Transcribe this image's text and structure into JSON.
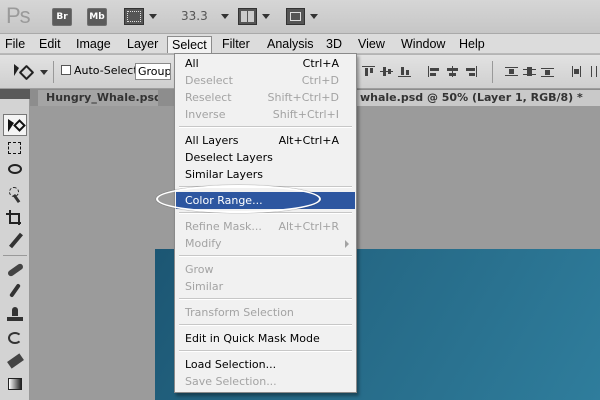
{
  "app": {
    "logo": "Ps",
    "bridge_label": "Br",
    "minibridge_label": "Mb",
    "zoom": "33.3"
  },
  "menubar": [
    {
      "label": "File"
    },
    {
      "label": "Edit"
    },
    {
      "label": "Image"
    },
    {
      "label": "Layer"
    },
    {
      "label": "Select"
    },
    {
      "label": "Filter"
    },
    {
      "label": "Analysis"
    },
    {
      "label": "3D"
    },
    {
      "label": "View"
    },
    {
      "label": "Window"
    },
    {
      "label": "Help"
    }
  ],
  "options": {
    "auto_select_label": "Auto-Select:",
    "group_value": "Group"
  },
  "tabs": {
    "first": "Hungry_Whale.psd @",
    "second": "whale.psd @ 50% (Layer 1, RGB/8) *"
  },
  "select_menu": {
    "all": {
      "label": "All",
      "shortcut": "Ctrl+A"
    },
    "deselect": {
      "label": "Deselect",
      "shortcut": "Ctrl+D"
    },
    "reselect": {
      "label": "Reselect",
      "shortcut": "Shift+Ctrl+D"
    },
    "inverse": {
      "label": "Inverse",
      "shortcut": "Shift+Ctrl+I"
    },
    "all_layers": {
      "label": "All Layers",
      "shortcut": "Alt+Ctrl+A"
    },
    "deselect_layers": {
      "label": "Deselect Layers"
    },
    "similar_layers": {
      "label": "Similar Layers"
    },
    "color_range": {
      "label": "Color Range..."
    },
    "refine_mask": {
      "label": "Refine Mask...",
      "shortcut": "Alt+Ctrl+R"
    },
    "modify": {
      "label": "Modify"
    },
    "grow": {
      "label": "Grow"
    },
    "similar": {
      "label": "Similar"
    },
    "transform_selection": {
      "label": "Transform Selection"
    },
    "quick_mask": {
      "label": "Edit in Quick Mask Mode"
    },
    "load_selection": {
      "label": "Load Selection..."
    },
    "save_selection": {
      "label": "Save Selection..."
    }
  },
  "colors": {
    "highlight": "#2d56a0",
    "canvas": "#256885"
  }
}
